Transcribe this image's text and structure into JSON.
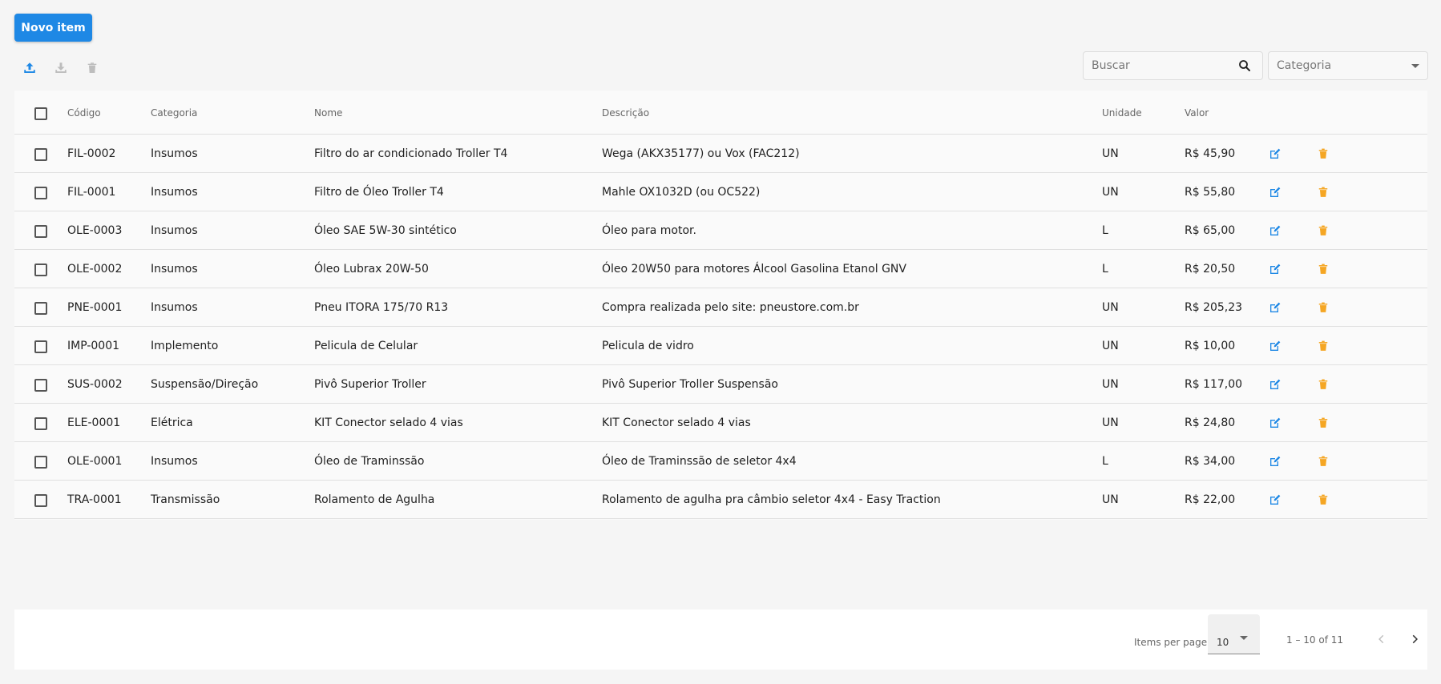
{
  "toolbar": {
    "new_item_label": "Novo item",
    "icons": [
      "upload-icon",
      "download-icon",
      "delete-icon"
    ],
    "search_placeholder": "Buscar",
    "category_placeholder": "Categoria"
  },
  "table": {
    "headers": {
      "codigo": "Código",
      "categoria": "Categoria",
      "nome": "Nome",
      "descricao": "Descrição",
      "unidade": "Unidade",
      "valor": "Valor"
    },
    "rows": [
      {
        "codigo": "FIL-0002",
        "categoria": "Insumos",
        "nome": "Filtro do ar condicionado Troller T4",
        "descricao": "Wega (AKX35177) ou Vox (FAC212)",
        "unidade": "UN",
        "valor": "R$ 45,90"
      },
      {
        "codigo": "FIL-0001",
        "categoria": "Insumos",
        "nome": "Filtro de Óleo Troller T4",
        "descricao": "Mahle OX1032D (ou OC522)",
        "unidade": "UN",
        "valor": "R$ 55,80"
      },
      {
        "codigo": "OLE-0003",
        "categoria": "Insumos",
        "nome": "Óleo SAE 5W-30 sintético",
        "descricao": "Óleo para motor.",
        "unidade": "L",
        "valor": "R$ 65,00"
      },
      {
        "codigo": "OLE-0002",
        "categoria": "Insumos",
        "nome": "Óleo Lubrax 20W-50",
        "descricao": "Óleo 20W50 para motores Álcool Gasolina Etanol GNV",
        "unidade": "L",
        "valor": "R$ 20,50"
      },
      {
        "codigo": "PNE-0001",
        "categoria": "Insumos",
        "nome": "Pneu ITORA 175/70 R13",
        "descricao": "Compra realizada pelo site: pneustore.com.br",
        "unidade": "UN",
        "valor": "R$ 205,23"
      },
      {
        "codigo": "IMP-0001",
        "categoria": "Implemento",
        "nome": "Pelicula de Celular",
        "descricao": "Pelicula de vidro",
        "unidade": "UN",
        "valor": "R$ 10,00"
      },
      {
        "codigo": "SUS-0002",
        "categoria": "Suspensão/Direção",
        "nome": "Pivô Superior Troller",
        "descricao": "Pivô Superior Troller Suspensão",
        "unidade": "UN",
        "valor": "R$ 117,00"
      },
      {
        "codigo": "ELE-0001",
        "categoria": "Elétrica",
        "nome": "KIT Conector selado 4 vias",
        "descricao": "KIT Conector selado 4 vias",
        "unidade": "UN",
        "valor": "R$ 24,80"
      },
      {
        "codigo": "OLE-0001",
        "categoria": "Insumos",
        "nome": "Óleo de Traminssão",
        "descricao": "Óleo de Traminssão de seletor 4x4",
        "unidade": "L",
        "valor": "R$ 34,00"
      },
      {
        "codigo": "TRA-0001",
        "categoria": "Transmissão",
        "nome": "Rolamento de Agulha",
        "descricao": "Rolamento de agulha pra câmbio seletor 4x4 - Easy Traction",
        "unidade": "UN",
        "valor": "R$ 22,00"
      }
    ],
    "row_actions": [
      "edit-icon",
      "trash-icon"
    ]
  },
  "paginator": {
    "items_per_page_label": "Items per page:",
    "items_per_page_value": "10",
    "range_label": "1 – 10 of 11"
  },
  "colors": {
    "primary": "#1e88e5",
    "edit": "#1e88e5",
    "delete": "#f5a623",
    "disabled": "#bdbdbd"
  }
}
